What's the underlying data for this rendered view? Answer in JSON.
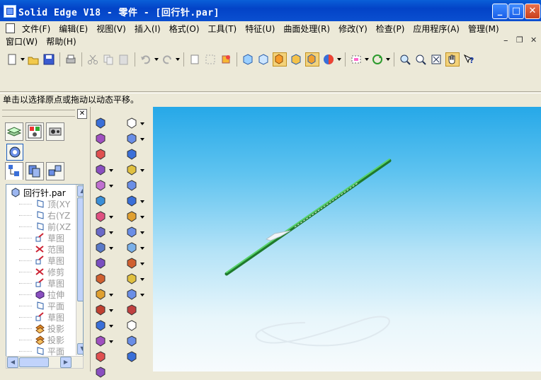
{
  "window": {
    "title": "Solid Edge V18 - 零件 - [回行针.par]",
    "min_label": "_",
    "max_label": "□",
    "close_label": "✕"
  },
  "menu": {
    "items": [
      "文件(F)",
      "编辑(E)",
      "视图(V)",
      "插入(I)",
      "格式(O)",
      "工具(T)",
      "特征(U)",
      "曲面处理(R)",
      "修改(Y)",
      "检查(P)",
      "应用程序(A)",
      "管理(M)"
    ],
    "row2": [
      "窗口(W)",
      "帮助(H)"
    ],
    "mdi_min": "–",
    "mdi_restore": "❐",
    "mdi_close": "✕"
  },
  "status": {
    "text": "单击以选择原点或拖动以动态平移。"
  },
  "tree": {
    "root": "回行针.par",
    "items": [
      "顶(XY",
      "右(YZ",
      "前(XZ",
      "草图",
      "范围",
      "草图",
      "修剪",
      "草图",
      "拉伸",
      "平面",
      "草图",
      "投影",
      "投影",
      "平面"
    ]
  },
  "pane": {
    "close_label": "✕"
  },
  "colors": {
    "title_bar": "#0343c7",
    "part": "#3db84a",
    "viewport_top": "#26a8e8"
  }
}
